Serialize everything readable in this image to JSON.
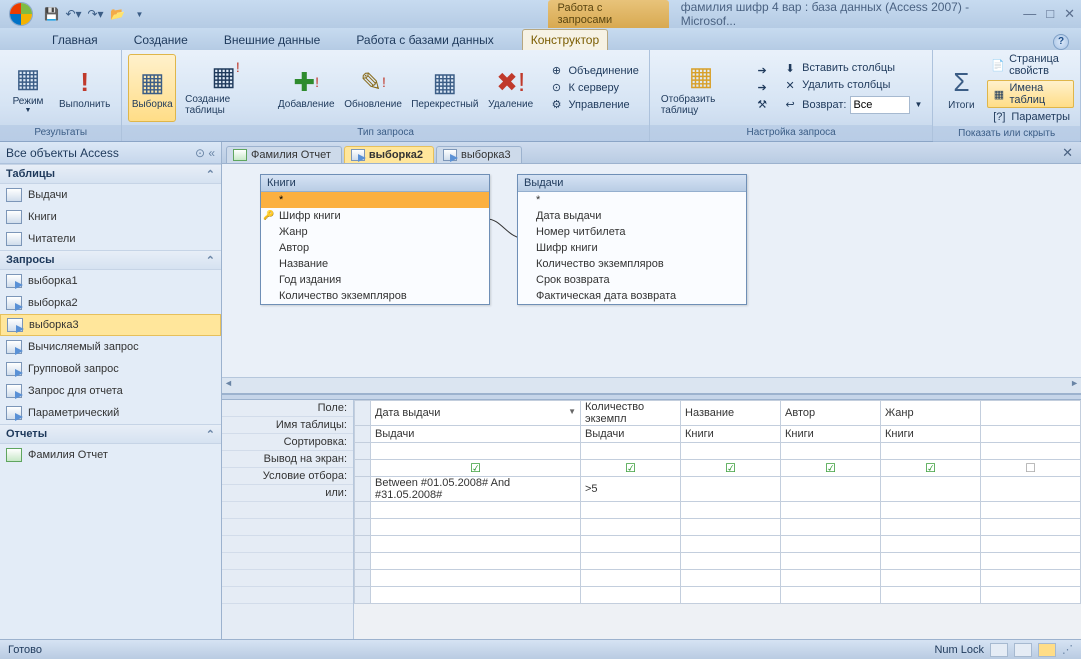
{
  "titlebar": {
    "context_tab": "Работа с запросами",
    "title": "фамилия шифр 4 вар : база данных (Access 2007) - Microsof..."
  },
  "tabs": {
    "home": "Главная",
    "create": "Создание",
    "external": "Внешние данные",
    "dbtools": "Работа с базами данных",
    "design": "Конструктор"
  },
  "ribbon": {
    "g_results": "Результаты",
    "mode": "Режим",
    "run": "Выполнить",
    "g_querytype": "Тип запроса",
    "select": "Выборка",
    "maketable": "Создание таблицы",
    "append": "Добавление",
    "update": "Обновление",
    "crosstab": "Перекрестный",
    "delete": "Удаление",
    "union": "Объединение",
    "passthrough": "К серверу",
    "datadef": "Управление",
    "g_querysetup": "Настройка запроса",
    "showtable": "Отобразить таблицу",
    "insertcols": "Вставить столбцы",
    "deletecols": "Удалить столбцы",
    "return": "Возврат:",
    "return_val": "Все",
    "g_showhide": "Показать или скрыть",
    "totals": "Итоги",
    "propsheet": "Страница свойств",
    "tablenames": "Имена таблиц",
    "params": "Параметры"
  },
  "nav": {
    "title": "Все объекты Access",
    "sec_tables": "Таблицы",
    "t1": "Выдачи",
    "t2": "Книги",
    "t3": "Читатели",
    "sec_queries": "Запросы",
    "q1": "выборка1",
    "q2": "выборка2",
    "q3": "выборка3",
    "q4": "Вычисляемый запрос",
    "q5": "Групповой запрос",
    "q6": "Запрос для отчета",
    "q7": "Параметрический",
    "sec_reports": "Отчеты",
    "r1": "Фамилия Отчет"
  },
  "doctabs": {
    "t1": "Фамилия Отчет",
    "t2": "выборка2",
    "t3": "выборка3"
  },
  "designer": {
    "box1_title": "Книги",
    "box1": {
      "all": "*",
      "f1": "Шифр книги",
      "f2": "Жанр",
      "f3": "Автор",
      "f4": "Название",
      "f5": "Год издания",
      "f6": "Количество экземпляров"
    },
    "box2_title": "Выдачи",
    "box2": {
      "all": "*",
      "f1": "Дата выдачи",
      "f2": "Номер читбилета",
      "f3": "Шифр книги",
      "f4": "Количество экземпляров",
      "f5": "Срок возврата",
      "f6": "Фактическая дата возврата"
    }
  },
  "gridlabels": {
    "field": "Поле:",
    "table": "Имя таблицы:",
    "sort": "Сортировка:",
    "show": "Вывод на экран:",
    "criteria": "Условие отбора:",
    "or": "или:"
  },
  "grid": {
    "c1": {
      "field": "Дата выдачи",
      "table": "Выдачи",
      "crit": "Between #01.05.2008# And #31.05.2008#"
    },
    "c2": {
      "field": "Количество экземпл",
      "table": "Выдачи",
      "crit": ">5"
    },
    "c3": {
      "field": "Название",
      "table": "Книги"
    },
    "c4": {
      "field": "Автор",
      "table": "Книги"
    },
    "c5": {
      "field": "Жанр",
      "table": "Книги"
    }
  },
  "status": {
    "ready": "Готово",
    "numlock": "Num Lock"
  }
}
